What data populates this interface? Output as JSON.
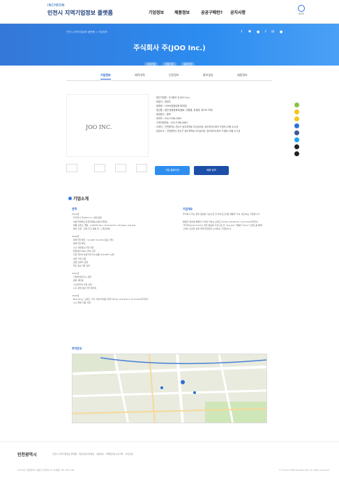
{
  "header": {
    "logo_top": "INCHEON",
    "logo_sub": "인천시 지역기업정보 플랫폼",
    "nav": [
      "기업정보",
      "제품정보",
      "공공구매란?",
      "공지사항"
    ],
    "sitemap": "SITE"
  },
  "hero": {
    "crumb": "인천시 지역기업정보 플랫폼 > 기업정보",
    "sns": "↑ ♥ ● f ✉ ●",
    "title": "주식회사 주(JOO Inc.)",
    "tags": [
      "여성기업",
      "창업기업",
      "벤처기업"
    ]
  },
  "tabs": [
    "기업정보",
    "제작내역",
    "인증정보",
    "홍보영상",
    "제품정보"
  ],
  "company": {
    "logo": "JOO INC.",
    "info": [
      "· 법인기업명 : 주식회사 주(JOO Inc.)",
      "· 대표자 : 한영주",
      "· 업종명 : 1999(업종유형 제조업)",
      "· 생산품 : 일반 응용완화제(음료, 미용품, 위생제, 레스토 커피)",
      "· 종업원수 : 중략",
      "· 연락처 : 032-5788-0687",
      "· 고객지원번호 : 032-5788-0687",
      "· 소재지 : 인천광역시 연수구 송도과학로 32(송도동, 송도테크노파크 IT센터) M동 411호",
      "· 공장주소 : 인천광역시 연수구 송도과학로 32(송도동, 송도테크노파크 IT센터) M동 411호"
    ],
    "btn_homepage": "기업 홈페이지",
    "btn_products": "제품 정보"
  },
  "intro": {
    "title": "기업소개",
    "history_title": "연혁",
    "history": [
      "2019년",
      "· 주식회사 주(JOO Inc.) 법인설립",
      "· 여성기업확인(인천지방중소벤처기업청)",
      "· 제품 브랜드 개발 : LAJOUN Skin, Prowesome, Shrapes, Jew Jew",
      "· 특허 출원 : 천연 추출 분말 및 그 제조방법",
      "",
      "2020년",
      "· 창업기업 확인 : Growth Voucher(중소기업)",
      "· 벤처기업 확인",
      "· 수출 유망중소기업 지정",
      "· 창업성장 R&D 과제 수행",
      "· 인천 제1회 여성기업 우수상품 GALLERY 선정",
      "· 성장 기업 인증",
      "· 모범 납세자 표창",
      "· 혁신 중소기업 선정",
      "",
      "2021년",
      "· 기업부설연구소 설립",
      "· 벤처 재인증",
      "· 수출바우처 사업 선정",
      "· 수출 유망 중소기업 재지정",
      "",
      "2022년",
      "· Branding : 브랜드 가치, 해외 마케팅 전략 Family Life Brand \"Joolimah(주리마)\"",
      "· 수출 물류 지원 사업"
    ],
    "overview_title": "기업개요",
    "overview": [
      "주식회사 주는 천연 원료를 기반으로 한 라이프스타일 제품을 기획, 생산하는 기업입니다.",
      "",
      "평범한 일상에 특별한 가치를 더하는 브랜드 Family Life Brand \"Joolimah(주리마)\"",
      "\"주리마(Joolimah)\"는 천연 원료를 기반으로 한 \"Jew Jew\" 제품과 \"Jarre\" 브랜드를 통해",
      "고객의 건강한 삶을 위해 끊임없이 노력하는 기업입니다."
    ],
    "location_title": "위치안내"
  },
  "footer": {
    "logo": "인천광역시",
    "links": "인천시 지역기업정보 플랫폼  ·  개인정보처리방침  ·  이용약관  ·  이메일무단수집거부  ·  사이트맵",
    "address": "(21554) 인천광역시 남동구 정각로 29 (구월동) TEL 032-120",
    "copyright": "© Incheon Metropolitan City. All rights reserved."
  },
  "colors": {
    "accent": "#2565d0",
    "hero": "#2c8cf0",
    "quick": [
      "#8bc34a",
      "#f5c518",
      "#f5c518",
      "#2b6fd6",
      "#3b5998",
      "#1da1f2",
      "#222222",
      "#222222"
    ]
  }
}
